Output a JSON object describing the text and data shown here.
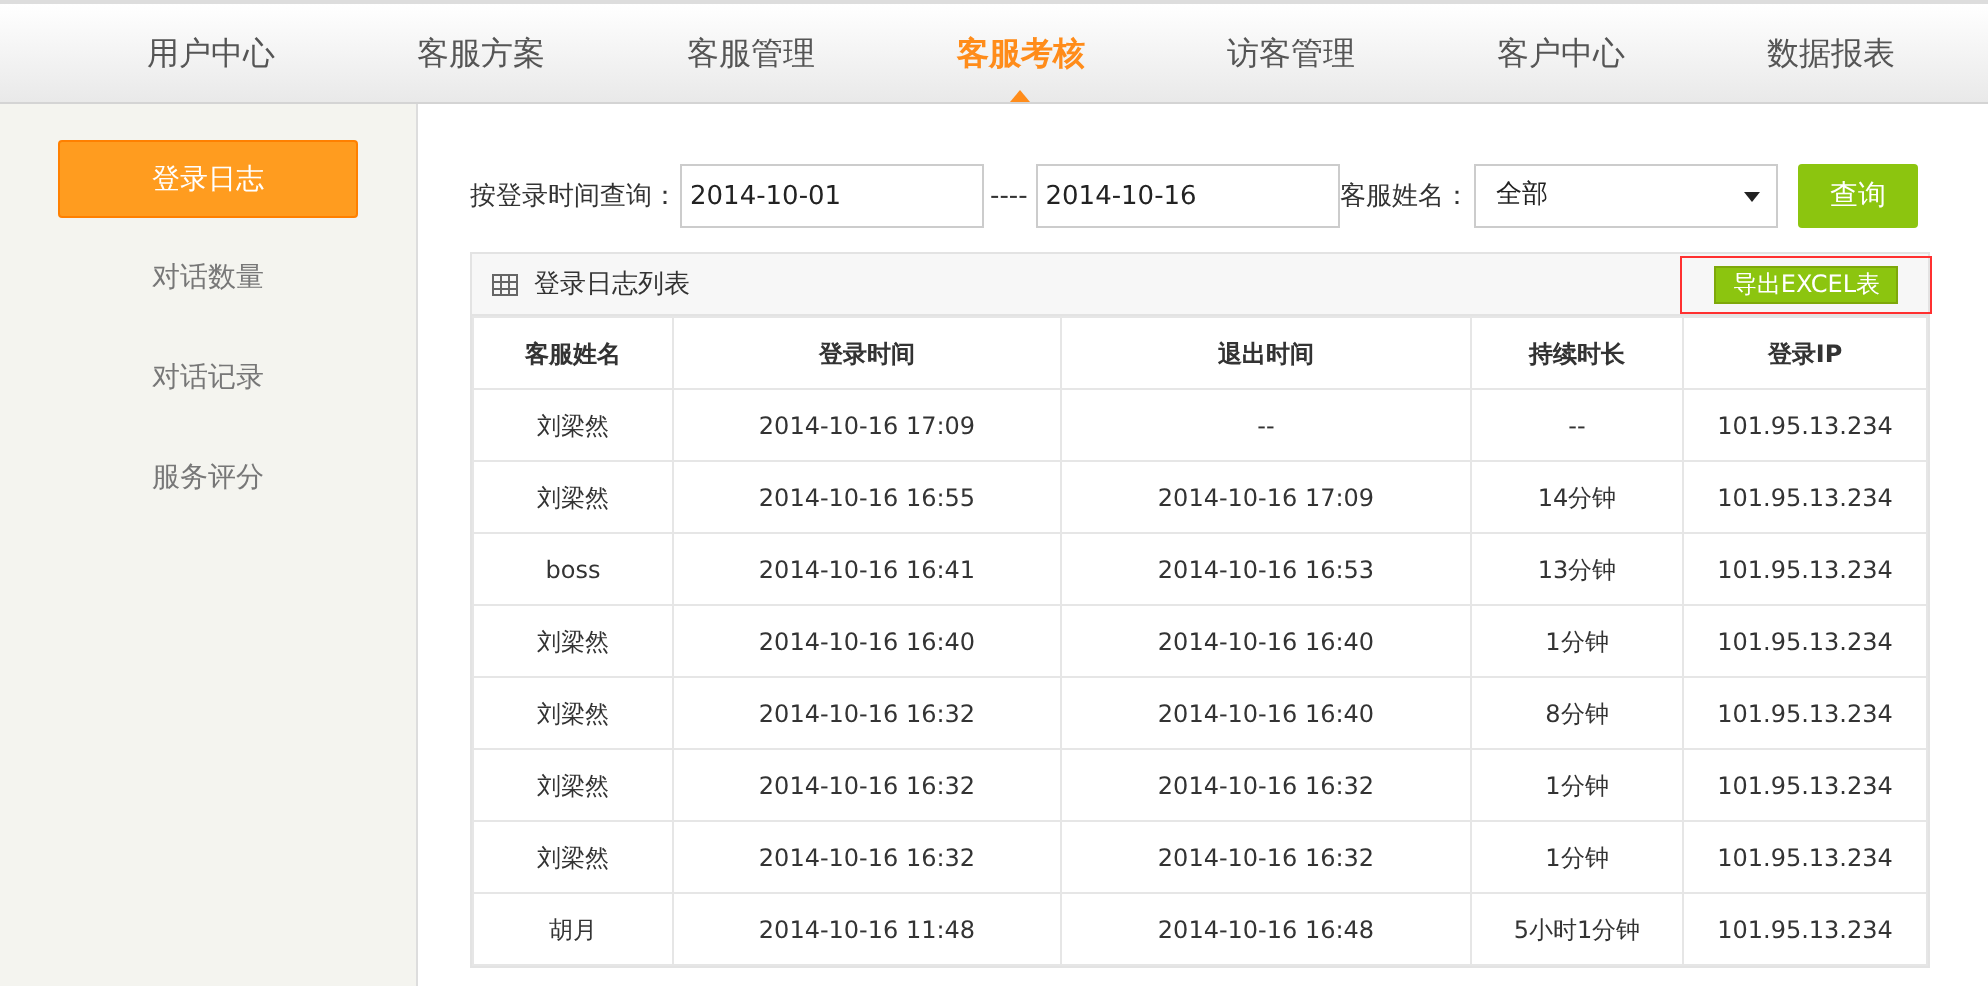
{
  "nav": [
    {
      "label": "用户中心",
      "selected": false
    },
    {
      "label": "客服方案",
      "selected": false
    },
    {
      "label": "客服管理",
      "selected": false
    },
    {
      "label": "客服考核",
      "selected": true
    },
    {
      "label": "访客管理",
      "selected": false
    },
    {
      "label": "客户中心",
      "selected": false
    },
    {
      "label": "数据报表",
      "selected": false
    }
  ],
  "sidebar": {
    "items": [
      {
        "label": "登录日志",
        "selected": true
      },
      {
        "label": "对话数量",
        "selected": false
      },
      {
        "label": "对话记录",
        "selected": false
      },
      {
        "label": "服务评分",
        "selected": false
      }
    ]
  },
  "filter": {
    "label": "按登录时间查询：",
    "start": "2014-10-01",
    "separator": "----",
    "end": "2014-10-16",
    "agent_label": "客服姓名：",
    "agent": "全部",
    "button": "查询"
  },
  "table": {
    "title": "登录日志列表",
    "export_button": "导出EXCEL表",
    "columns": [
      "客服姓名",
      "登录时间",
      "退出时间",
      "持续时长",
      "登录IP"
    ],
    "rows": [
      [
        "刘梁然",
        "2014-10-16 17:09",
        "--",
        "--",
        "101.95.13.234"
      ],
      [
        "刘梁然",
        "2014-10-16 16:55",
        "2014-10-16 17:09",
        "14分钟",
        "101.95.13.234"
      ],
      [
        "boss",
        "2014-10-16 16:41",
        "2014-10-16 16:53",
        "13分钟",
        "101.95.13.234"
      ],
      [
        "刘梁然",
        "2014-10-16 16:40",
        "2014-10-16 16:40",
        "1分钟",
        "101.95.13.234"
      ],
      [
        "刘梁然",
        "2014-10-16 16:32",
        "2014-10-16 16:40",
        "8分钟",
        "101.95.13.234"
      ],
      [
        "刘梁然",
        "2014-10-16 16:32",
        "2014-10-16 16:32",
        "1分钟",
        "101.95.13.234"
      ],
      [
        "刘梁然",
        "2014-10-16 16:32",
        "2014-10-16 16:32",
        "1分钟",
        "101.95.13.234"
      ],
      [
        "胡月",
        "2014-10-16 11:48",
        "2014-10-16 16:48",
        "5小时1分钟",
        "101.95.13.234"
      ]
    ]
  }
}
